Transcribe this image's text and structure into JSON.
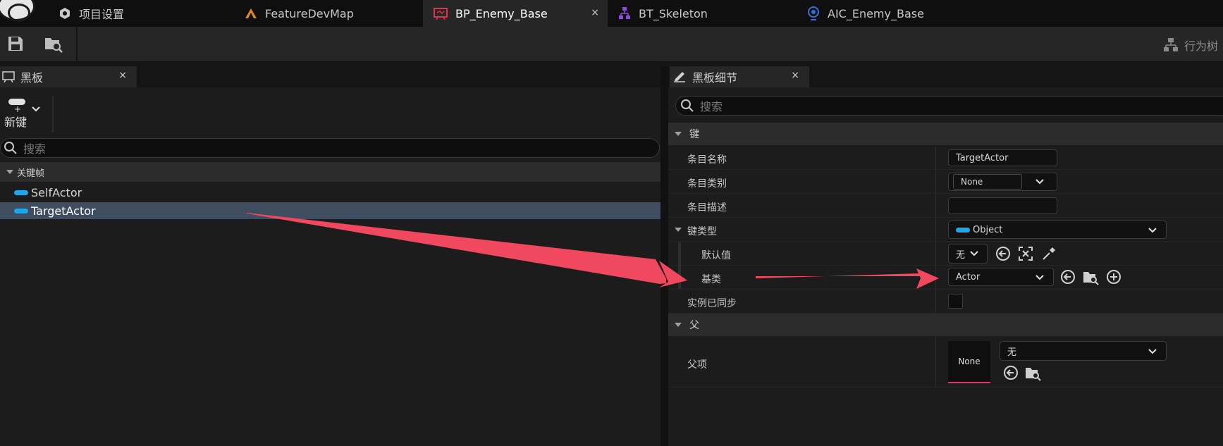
{
  "tabs": [
    {
      "label": "项目设置",
      "icon": "settings-gear-icon"
    },
    {
      "label": "FeatureDevMap",
      "icon": "level-map-icon"
    },
    {
      "label": "BP_Enemy_Base",
      "icon": "blueprint-icon",
      "active": true,
      "close": "×"
    },
    {
      "label": "BT_Skeleton",
      "icon": "behavior-tree-icon"
    },
    {
      "label": "AIC_Enemy_Base",
      "icon": "ai-controller-icon"
    }
  ],
  "toolbar": {
    "right_label": "行为树"
  },
  "left_panel": {
    "tab_label": "黑板",
    "tab_close": "×",
    "new_key_label": "新键",
    "search_placeholder": "搜索",
    "category": "关键帧",
    "keys": [
      {
        "label": "SelfActor",
        "selected": false
      },
      {
        "label": "TargetActor",
        "selected": true
      }
    ]
  },
  "right_panel": {
    "tab_label": "黑板细节",
    "tab_close": "×",
    "search_placeholder": "搜索",
    "section_key": "键",
    "entry_name_label": "条目名称",
    "entry_name_value": "TargetActor",
    "entry_category_label": "条目类别",
    "entry_category_value": "None",
    "entry_desc_label": "条目描述",
    "entry_desc_value": "",
    "key_type_label": "键类型",
    "key_type_value": "Object",
    "default_label": "默认值",
    "default_value": "无",
    "base_class_label": "基类",
    "base_class_value": "Actor",
    "instance_synced_label": "实例已同步",
    "section_parent": "父",
    "parent_label": "父项",
    "parent_thumb": "None",
    "parent_value": "无"
  },
  "colors": {
    "accent_blue": "#1da6e8",
    "arrow": "#f0485e",
    "selected_row": "#3e4d5f"
  }
}
